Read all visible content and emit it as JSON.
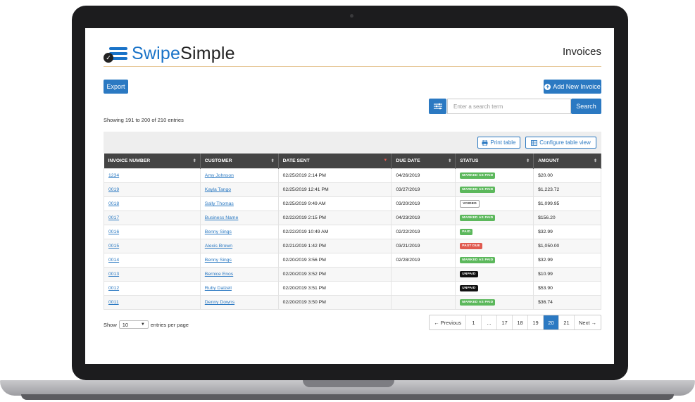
{
  "header": {
    "logo_part1": "Swipe",
    "logo_part2": "Simple",
    "page_title": "Invoices"
  },
  "toolbar": {
    "export_label": "Export",
    "add_new_label": "Add New Invoice"
  },
  "search": {
    "placeholder": "Enter a search term",
    "button_label": "Search"
  },
  "showing_text": "Showing 191 to 200 of 210 entries",
  "table_tools": {
    "print_label": "Print table",
    "configure_label": "Configure table view"
  },
  "table": {
    "columns": [
      "INVOICE NUMBER",
      "CUSTOMER",
      "DATE SENT",
      "DUE DATE",
      "STATUS",
      "AMOUNT"
    ],
    "sort_column": "DATE SENT",
    "rows": [
      {
        "invoice": "1234",
        "customer": "Amy Johnson",
        "date_sent": "02/25/2019 2:14 PM",
        "due_date": "04/26/2019",
        "status": "MARKED AS PAID",
        "amount": "$20.00"
      },
      {
        "invoice": "0019",
        "customer": "Kayla Tango",
        "date_sent": "02/25/2019 12:41 PM",
        "due_date": "03/27/2019",
        "status": "MARKED AS PAID",
        "amount": "$1,223.72"
      },
      {
        "invoice": "0018",
        "customer": "Sally Thomas",
        "date_sent": "02/25/2019 9:49 AM",
        "due_date": "03/20/2019",
        "status": "VOIDED",
        "amount": "$1,099.95"
      },
      {
        "invoice": "0017",
        "customer": "Business Name",
        "date_sent": "02/22/2019 2:15 PM",
        "due_date": "04/23/2019",
        "status": "MARKED AS PAID",
        "amount": "$156.20"
      },
      {
        "invoice": "0016",
        "customer": "Benny Sings",
        "date_sent": "02/22/2019 10:49 AM",
        "due_date": "02/22/2019",
        "status": "PAID",
        "amount": "$32.99"
      },
      {
        "invoice": "0015",
        "customer": "Alexis Brown",
        "date_sent": "02/21/2019 1:42 PM",
        "due_date": "03/21/2019",
        "status": "PAST DUE",
        "amount": "$1,050.00"
      },
      {
        "invoice": "0014",
        "customer": "Benny Sings",
        "date_sent": "02/20/2019 3:56 PM",
        "due_date": "02/28/2019",
        "status": "MARKED AS PAID",
        "amount": "$32.99"
      },
      {
        "invoice": "0013",
        "customer": "Bernice Enos",
        "date_sent": "02/20/2019 3:52 PM",
        "due_date": "",
        "status": "UNPAID",
        "amount": "$10.99"
      },
      {
        "invoice": "0012",
        "customer": "Ruby Dalzell",
        "date_sent": "02/20/2019 3:51 PM",
        "due_date": "",
        "status": "UNPAID",
        "amount": "$53.90"
      },
      {
        "invoice": "0011",
        "customer": "Denny Downs",
        "date_sent": "02/20/2019 3:50 PM",
        "due_date": "",
        "status": "MARKED AS PAID",
        "amount": "$36.74"
      }
    ]
  },
  "status_colors": {
    "MARKED AS PAID": {
      "bg": "#5cb85c",
      "fg": "#ffffff"
    },
    "PAID": {
      "bg": "#5cb85c",
      "fg": "#ffffff"
    },
    "VOIDED": {
      "bg": "#ffffff",
      "fg": "#333333",
      "border": "#999999"
    },
    "PAST DUE": {
      "bg": "#e05a4f",
      "fg": "#ffffff"
    },
    "UNPAID": {
      "bg": "#111111",
      "fg": "#ffffff"
    }
  },
  "footer": {
    "show_label": "Show",
    "per_page_value": "10",
    "entries_label": "entries per page",
    "pagination": [
      {
        "label": "← Previous",
        "active": false
      },
      {
        "label": "1",
        "active": false
      },
      {
        "label": "...",
        "active": false
      },
      {
        "label": "17",
        "active": false
      },
      {
        "label": "18",
        "active": false
      },
      {
        "label": "19",
        "active": false
      },
      {
        "label": "20",
        "active": true
      },
      {
        "label": "21",
        "active": false
      },
      {
        "label": "Next →",
        "active": false
      }
    ]
  },
  "colors": {
    "accent": "#2b79c2",
    "header_bg": "#444444"
  }
}
